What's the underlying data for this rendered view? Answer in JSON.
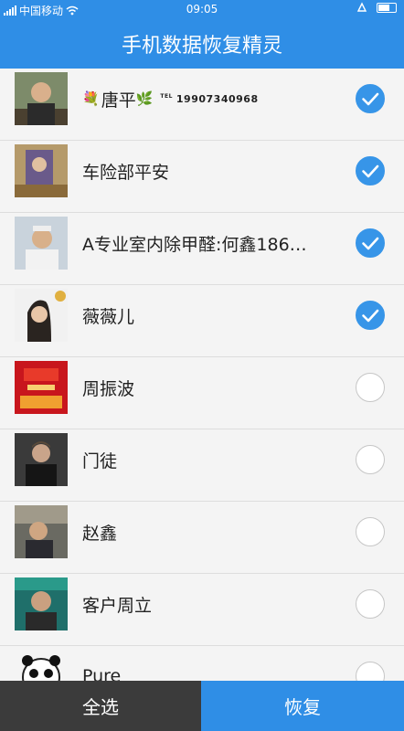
{
  "status_bar": {
    "carrier": "中国移动",
    "time": "09:05",
    "battery_level": 0.6
  },
  "header": {
    "title": "手机数据恢复精灵"
  },
  "contacts": [
    {
      "decoration": "💐",
      "name": "唐平",
      "leaf": "🌿",
      "tel_prefix": "TEL",
      "tel": "19907340968",
      "checked": true
    },
    {
      "name": "车险部平安",
      "checked": true
    },
    {
      "name": "A专业室内除甲醛:何鑫186…",
      "checked": true
    },
    {
      "name": "薇薇儿",
      "checked": true
    },
    {
      "name": "周振波",
      "checked": false
    },
    {
      "name": "门徒",
      "checked": false
    },
    {
      "name": "赵鑫",
      "checked": false
    },
    {
      "name": "客户周立",
      "checked": false
    },
    {
      "name": "Pure",
      "checked": false
    }
  ],
  "bottom_bar": {
    "select_all_label": "全选",
    "restore_label": "恢复"
  },
  "colors": {
    "accent": "#2f8ee6",
    "check_on": "#3795e8",
    "dark_button": "#3b3b3b"
  }
}
